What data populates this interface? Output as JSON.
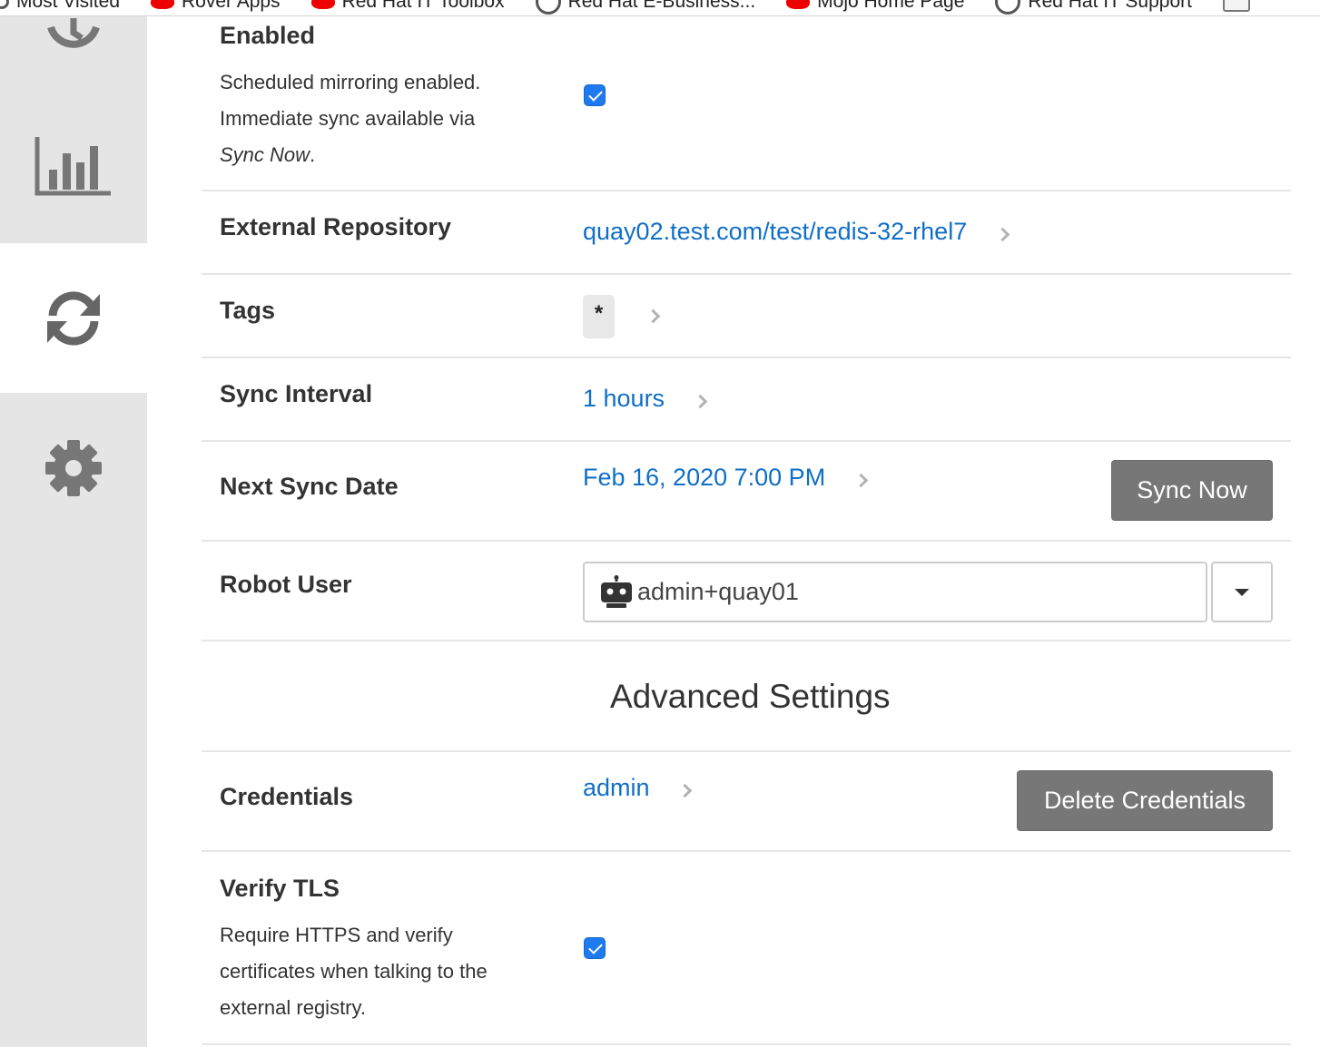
{
  "bookmarks": [
    {
      "label": "Most Visited",
      "icon": "search-icon"
    },
    {
      "label": "Rover Apps",
      "icon": "redhat-icon"
    },
    {
      "label": "Red Hat IT Toolbox",
      "icon": "redhat-icon"
    },
    {
      "label": "Red Hat E-Business...",
      "icon": "globe-icon"
    },
    {
      "label": "Mojo Home Page",
      "icon": "redhat-icon"
    },
    {
      "label": "Red Hat IT Support",
      "icon": "globe-icon"
    },
    {
      "label": "",
      "icon": "folder-icon"
    }
  ],
  "sidebar": {
    "items": [
      {
        "name": "history",
        "icon": "history-icon"
      },
      {
        "name": "usage-logs",
        "icon": "bar-chart-icon"
      },
      {
        "name": "mirroring",
        "icon": "refresh-icon",
        "active": true
      },
      {
        "name": "settings",
        "icon": "gear-icon"
      }
    ]
  },
  "mirroring": {
    "enabled": {
      "label": "Enabled",
      "desc_line1": "Scheduled mirroring enabled.",
      "desc_line2": "Immediate sync available via",
      "desc_italic": "Sync Now",
      "desc_end": ".",
      "checked": true
    },
    "external_repository": {
      "label": "External Repository",
      "value": "quay02.test.com/test/redis-32-rhel7"
    },
    "tags": {
      "label": "Tags",
      "value": "*"
    },
    "sync_interval": {
      "label": "Sync Interval",
      "value": "1 hours"
    },
    "next_sync_date": {
      "label": "Next Sync Date",
      "value": "Feb 16, 2020 7:00 PM",
      "button": "Sync Now"
    },
    "robot_user": {
      "label": "Robot User",
      "value": "admin+quay01"
    },
    "advanced_title": "Advanced Settings",
    "credentials": {
      "label": "Credentials",
      "value": "admin",
      "button": "Delete Credentials"
    },
    "verify_tls": {
      "label": "Verify TLS",
      "desc_line1": "Require HTTPS and verify",
      "desc_line2": "certificates when talking to the",
      "desc_line3": "external registry.",
      "checked": true
    }
  },
  "colors": {
    "link": "#0f6fc6",
    "checkbox": "#1f7aef",
    "button": "#777777",
    "sidebar": "#e5e5e5"
  }
}
